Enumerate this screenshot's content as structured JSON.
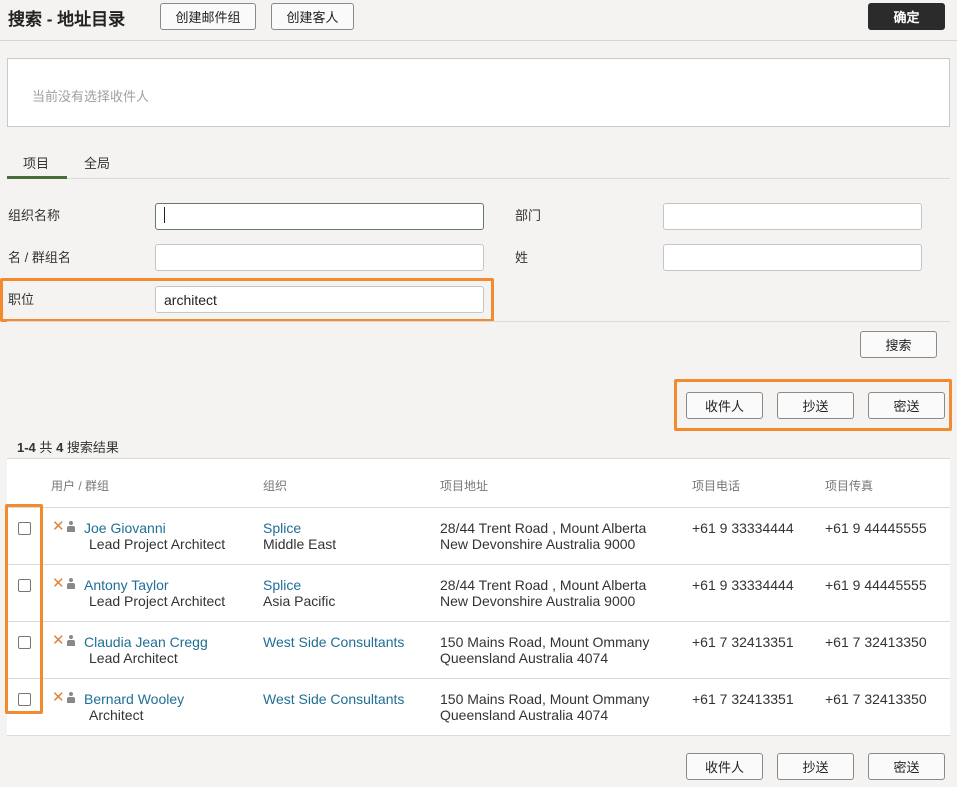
{
  "header": {
    "title": "搜索 - 地址目录",
    "create_group_label": "创建邮件组",
    "create_guest_label": "创建客人",
    "confirm_label": "确定"
  },
  "recipients": {
    "empty_text": "当前没有选择收件人"
  },
  "tabs": [
    {
      "label": "项目"
    },
    {
      "label": "全局"
    }
  ],
  "form": {
    "org_label": "组织名称",
    "org_value": "",
    "dept_label": "部门",
    "dept_value": "",
    "first_label": "名 / 群组名",
    "first_value": "",
    "last_label": "姓",
    "last_value": "",
    "position_label": "职位",
    "position_value": "architect",
    "search_label": "搜索"
  },
  "actions": {
    "to_label": "收件人",
    "cc_label": "抄送",
    "bcc_label": "密送"
  },
  "results": {
    "range": "1-4",
    "of_label": "共",
    "total": "4",
    "suffix": "搜索结果",
    "columns": [
      "用户 / 群组",
      "组织",
      "项目地址",
      "项目电话",
      "项目传真"
    ],
    "rows": [
      {
        "name": "Joe Giovanni",
        "title": "Lead Project Architect",
        "org": "Splice",
        "org_sub": "Middle East",
        "addr1": "28/44 Trent Road , Mount Alberta",
        "addr2": "New Devonshire Australia 9000",
        "phone": "+61 9 33334444",
        "fax": "+61 9 44445555"
      },
      {
        "name": "Antony Taylor",
        "title": "Lead Project Architect",
        "org": "Splice",
        "org_sub": "Asia Pacific",
        "addr1": "28/44 Trent Road , Mount Alberta",
        "addr2": "New Devonshire Australia 9000",
        "phone": "+61 9 33334444",
        "fax": "+61 9 44445555"
      },
      {
        "name": "Claudia Jean Cregg",
        "title": "Lead Architect",
        "org": "West Side Consultants",
        "org_sub": "",
        "addr1": "150 Mains Road, Mount Ommany",
        "addr2": "Queensland Australia 4074",
        "phone": "+61 7 32413351",
        "fax": "+61 7 32413350"
      },
      {
        "name": "Bernard Wooley",
        "title": "Architect",
        "org": "West Side Consultants",
        "org_sub": "",
        "addr1": "150 Mains Road, Mount Ommany",
        "addr2": "Queensland Australia 4074",
        "phone": "+61 7 32413351",
        "fax": "+61 7 32413350"
      }
    ]
  },
  "highlight_color": "#f28a2e"
}
